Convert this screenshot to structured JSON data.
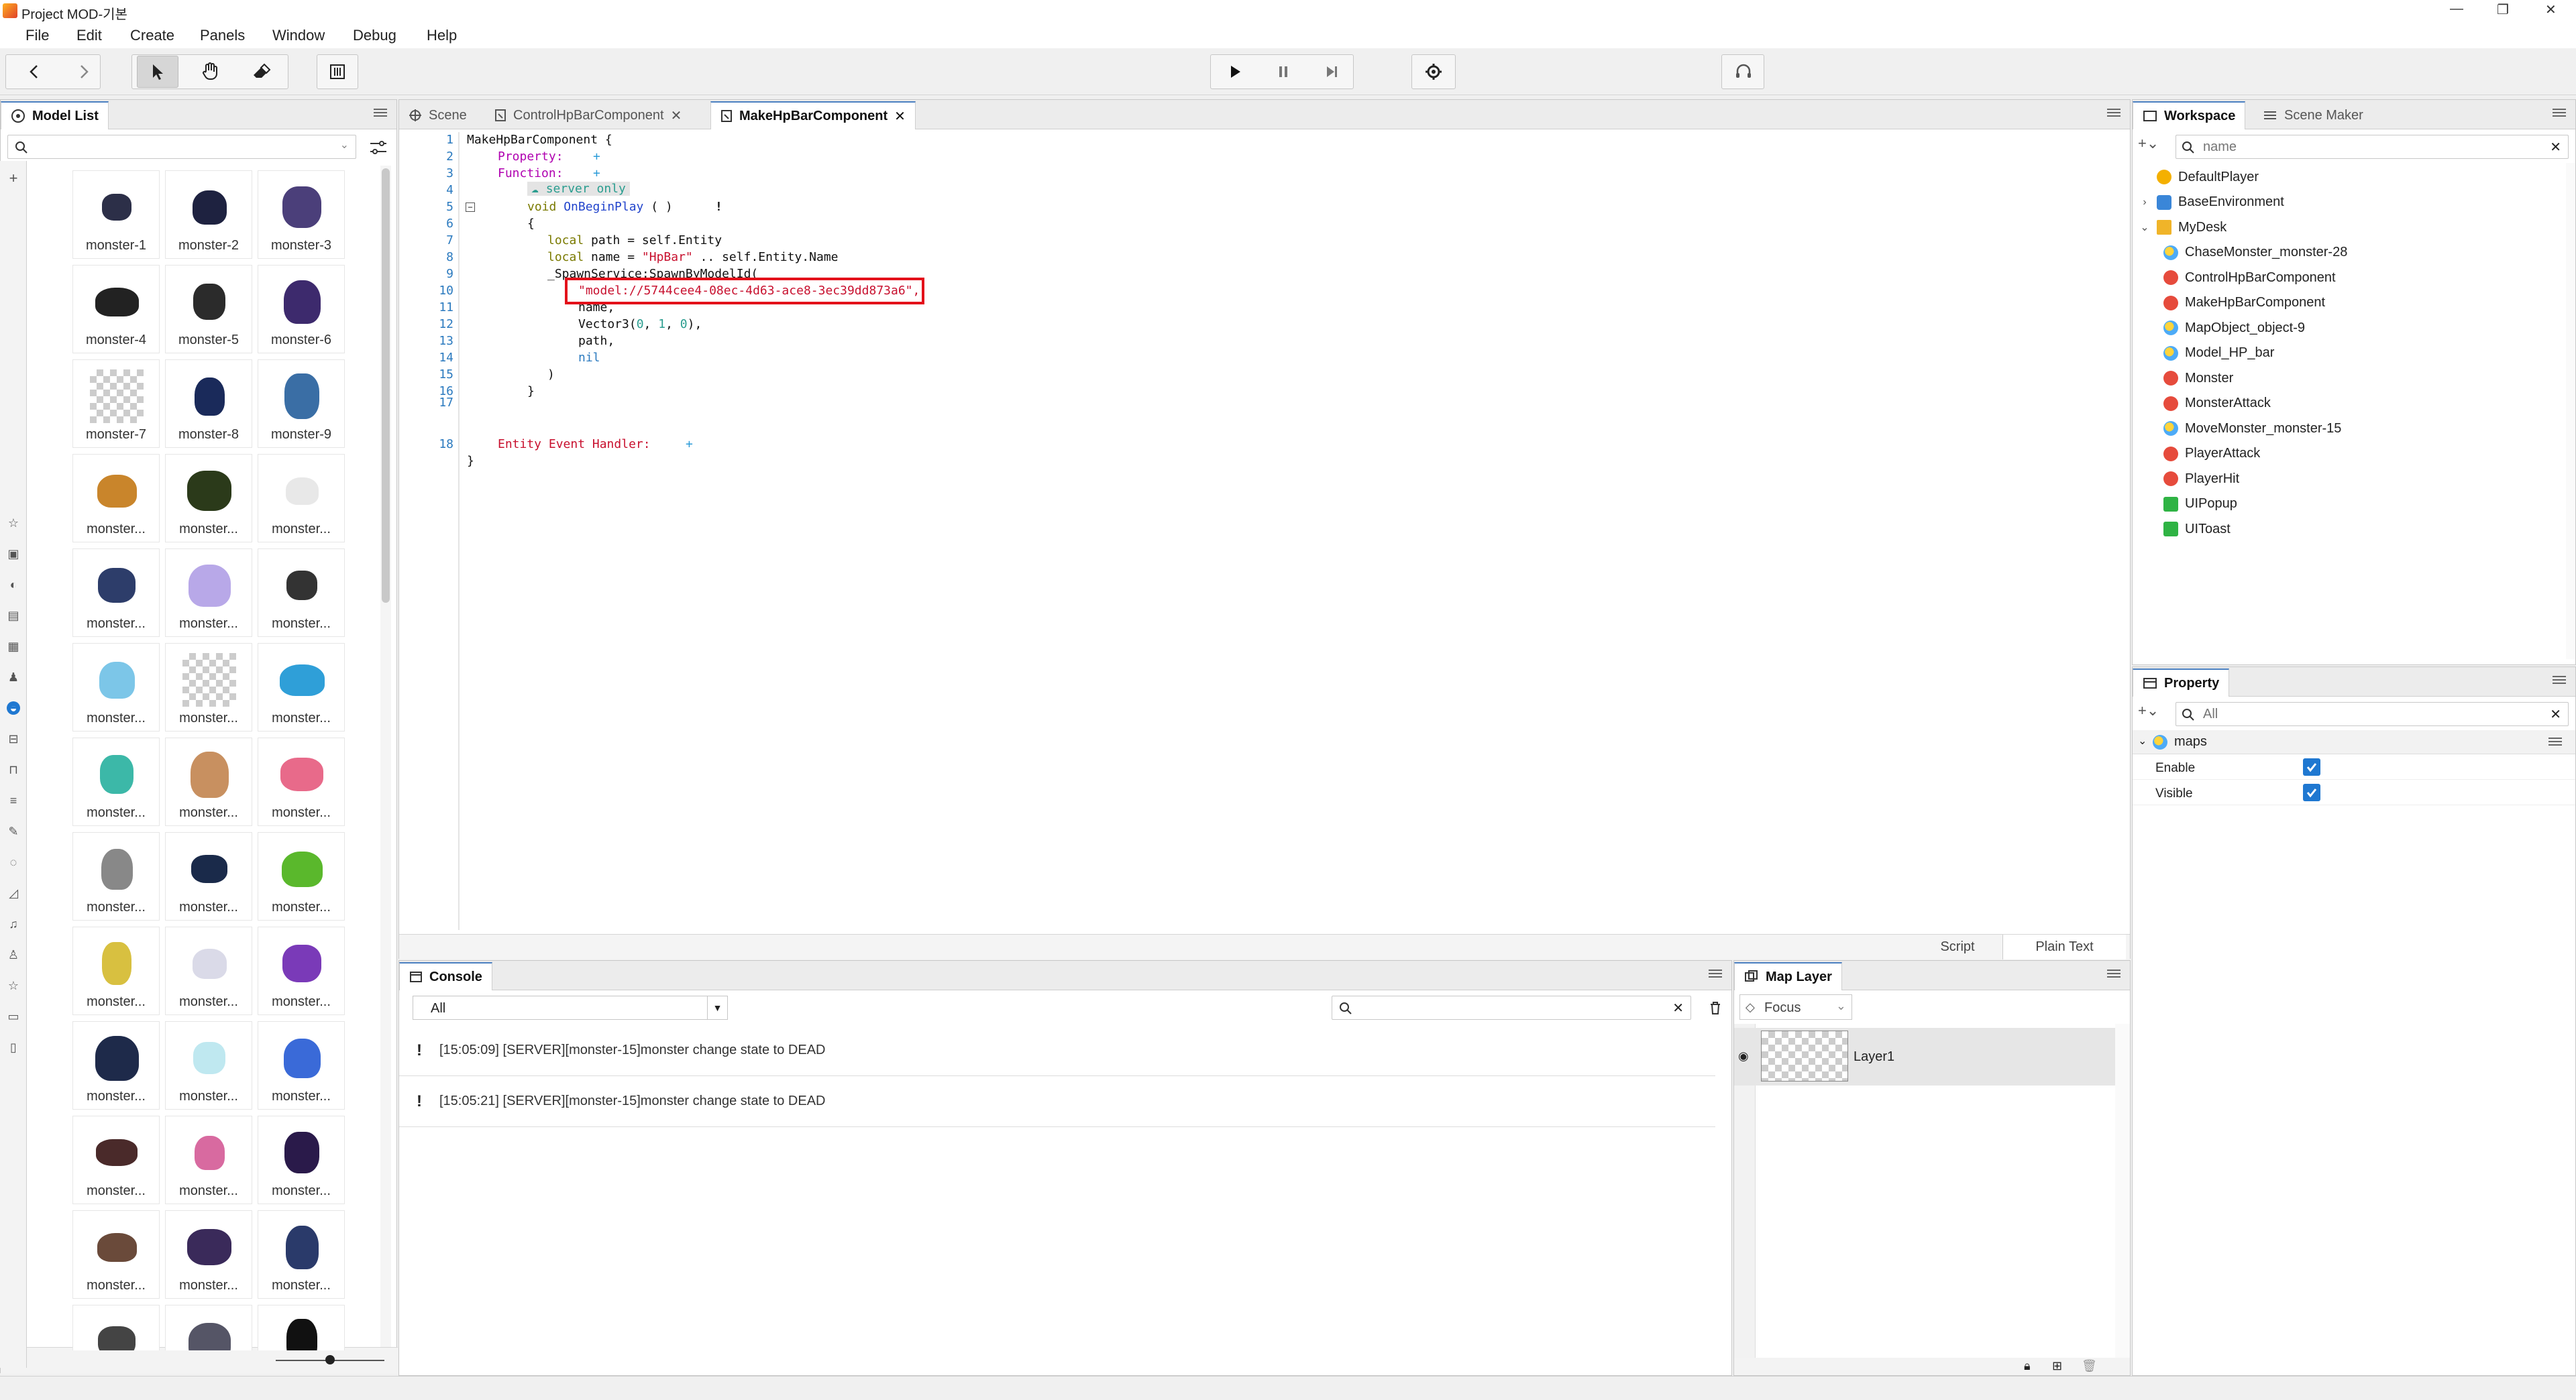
{
  "window": {
    "title": "Project MOD-기본"
  },
  "menu": [
    "File",
    "Edit",
    "Create",
    "Panels",
    "Window",
    "Debug",
    "Help"
  ],
  "model_list": {
    "title": "Model List",
    "search_placeholder": "",
    "items": [
      "monster-1",
      "monster-2",
      "monster-3",
      "monster-4",
      "monster-5",
      "monster-6",
      "monster-7",
      "monster-8",
      "monster-9",
      "monster...",
      "monster...",
      "monster...",
      "monster...",
      "monster...",
      "monster...",
      "monster...",
      "monster...",
      "monster...",
      "monster...",
      "monster...",
      "monster...",
      "monster...",
      "monster...",
      "monster...",
      "monster...",
      "monster...",
      "monster...",
      "monster...",
      "monster...",
      "monster...",
      "monster...",
      "monster...",
      "monster...",
      "monster...",
      "monster...",
      "monster...",
      "",
      "",
      ""
    ]
  },
  "editor": {
    "tabs": [
      "Scene",
      "ControlHpBarComponent",
      "MakeHpBarComponent"
    ],
    "active_tab": 2,
    "lines": [
      {
        "n": "1",
        "t": "MakeHpBarComponent {"
      },
      {
        "n": "2",
        "t": "Property:"
      },
      {
        "n": "3",
        "t": "Function:"
      },
      {
        "n": "4",
        "t": "server only"
      },
      {
        "n": "5",
        "t": "void OnBeginPlay ( )"
      },
      {
        "n": "6",
        "t": "{"
      },
      {
        "n": "7",
        "t": "local path = self.Entity"
      },
      {
        "n": "8",
        "t": "local name = \"HpBar\" .. self.Entity.Name"
      },
      {
        "n": "9",
        "t": "_SpawnService:SpawnByModelId("
      },
      {
        "n": "10",
        "t": "\"model://5744cee4-08ec-4d63-ace8-3ec39dd873a6\","
      },
      {
        "n": "11",
        "t": "name,"
      },
      {
        "n": "12",
        "t": "Vector3(0, 1, 0),"
      },
      {
        "n": "13",
        "t": "path,"
      },
      {
        "n": "14",
        "t": "nil"
      },
      {
        "n": "15",
        "t": ")"
      },
      {
        "n": "16",
        "t": "}"
      },
      {
        "n": "17",
        "t": ""
      },
      {
        "n": "18",
        "t": "Entity Event Handler:"
      },
      {
        "n": "",
        "t": "}"
      }
    ],
    "plus": "+",
    "bang": "!",
    "bottom_tabs": [
      "Script",
      "Plain Text"
    ]
  },
  "console": {
    "title": "Console",
    "filter": "All",
    "messages": [
      "[15:05:09] [SERVER][monster-15]monster change state to DEAD",
      "[15:05:21] [SERVER][monster-15]monster change state to DEAD"
    ]
  },
  "map_layer": {
    "title": "Map Layer",
    "focus": "Focus",
    "layers": [
      "Layer1"
    ]
  },
  "workspace": {
    "tabs": [
      "Workspace",
      "Scene Maker"
    ],
    "search_placeholder": "name",
    "items": [
      {
        "label": "DefaultPlayer",
        "icon": "player-icon",
        "depth": 0,
        "caret": ""
      },
      {
        "label": "BaseEnvironment",
        "icon": "base-icon",
        "depth": 0,
        "caret": ">"
      },
      {
        "label": "MyDesk",
        "icon": "folder-icon",
        "depth": 0,
        "caret": "v"
      },
      {
        "label": "ChaseMonster_monster-28",
        "icon": "map-object-icon",
        "depth": 1,
        "caret": ""
      },
      {
        "label": "ControlHpBarComponent",
        "icon": "component-icon",
        "depth": 1,
        "caret": ""
      },
      {
        "label": "MakeHpBarComponent",
        "icon": "component-icon",
        "depth": 1,
        "caret": ""
      },
      {
        "label": "MapObject_object-9",
        "icon": "map-object-icon",
        "depth": 1,
        "caret": ""
      },
      {
        "label": "Model_HP_bar",
        "icon": "map-object-icon",
        "depth": 1,
        "caret": ""
      },
      {
        "label": "Monster",
        "icon": "component-icon",
        "depth": 1,
        "caret": ""
      },
      {
        "label": "MonsterAttack",
        "icon": "component-icon",
        "depth": 1,
        "caret": ""
      },
      {
        "label": "MoveMonster_monster-15",
        "icon": "map-object-icon",
        "depth": 1,
        "caret": ""
      },
      {
        "label": "PlayerAttack",
        "icon": "component-icon",
        "depth": 1,
        "caret": ""
      },
      {
        "label": "PlayerHit",
        "icon": "component-icon",
        "depth": 1,
        "caret": ""
      },
      {
        "label": "UIPopup",
        "icon": "ui-icon",
        "depth": 1,
        "caret": ""
      },
      {
        "label": "UIToast",
        "icon": "ui-icon",
        "depth": 1,
        "caret": ""
      }
    ]
  },
  "property": {
    "title": "Property",
    "search_placeholder": "All",
    "group": "maps",
    "rows": [
      {
        "label": "Enable",
        "checked": true
      },
      {
        "label": "Visible",
        "checked": true
      }
    ]
  },
  "colors": {
    "accent": "#1f78d1",
    "highlight": "#e3101a",
    "tab_active_border": "#4a7fc0"
  }
}
